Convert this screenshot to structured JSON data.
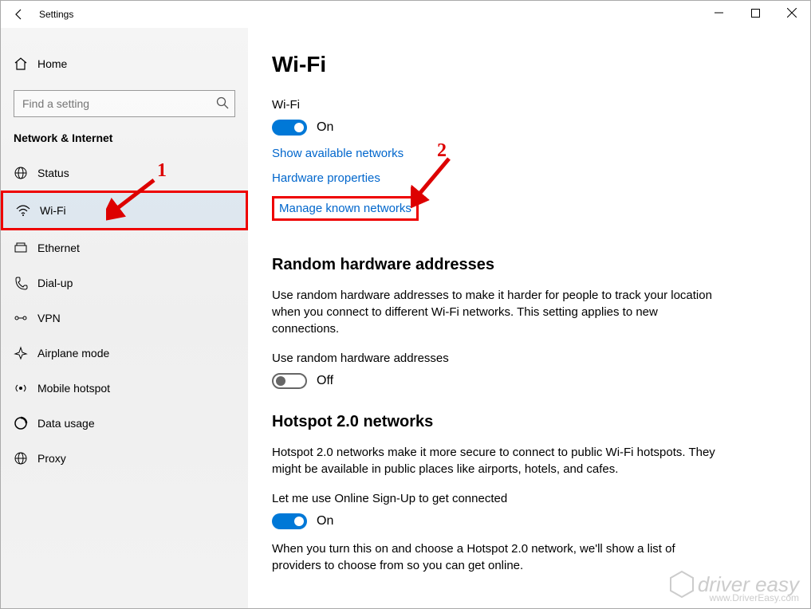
{
  "titlebar": {
    "title": "Settings"
  },
  "sidebar": {
    "home": "Home",
    "search_placeholder": "Find a setting",
    "category": "Network & Internet",
    "items": [
      {
        "label": "Status"
      },
      {
        "label": "Wi-Fi"
      },
      {
        "label": "Ethernet"
      },
      {
        "label": "Dial-up"
      },
      {
        "label": "VPN"
      },
      {
        "label": "Airplane mode"
      },
      {
        "label": "Mobile hotspot"
      },
      {
        "label": "Data usage"
      },
      {
        "label": "Proxy"
      }
    ]
  },
  "main": {
    "title": "Wi-Fi",
    "wifi_label": "Wi-Fi",
    "wifi_state": "On",
    "links": {
      "show_available": "Show available networks",
      "hardware": "Hardware properties",
      "manage": "Manage known networks"
    },
    "random": {
      "heading": "Random hardware addresses",
      "desc": "Use random hardware addresses to make it harder for people to track your location when you connect to different Wi-Fi networks. This setting applies to new connections.",
      "toggle_label": "Use random hardware addresses",
      "state": "Off"
    },
    "hotspot": {
      "heading": "Hotspot 2.0 networks",
      "desc": "Hotspot 2.0 networks make it more secure to connect to public Wi-Fi hotspots. They might be available in public places like airports, hotels, and cafes.",
      "toggle_label": "Let me use Online Sign-Up to get connected",
      "state": "On",
      "desc2": "When you turn this on and choose a Hotspot 2.0 network, we'll show a list of providers to choose from so you can get online."
    }
  },
  "annotations": {
    "one": "1",
    "two": "2"
  },
  "watermark": {
    "brand": "driver easy",
    "url": "www.DriverEasy.com"
  }
}
